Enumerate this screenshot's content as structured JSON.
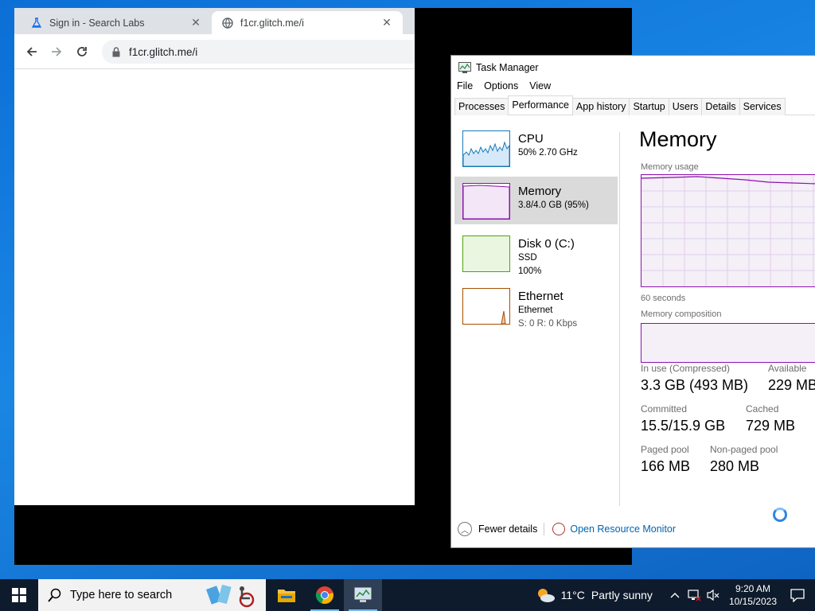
{
  "browser": {
    "tabs": [
      {
        "title": "Sign in - Search Labs",
        "icon": "flask-icon"
      },
      {
        "title": "f1cr.glitch.me/i",
        "icon": "globe-icon"
      }
    ],
    "url": "f1cr.glitch.me/i"
  },
  "task_manager": {
    "title": "Task Manager",
    "menu": [
      "File",
      "Options",
      "View"
    ],
    "tabs": [
      "Processes",
      "Performance",
      "App history",
      "Startup",
      "Users",
      "Details",
      "Services"
    ],
    "active_tab": "Performance",
    "sidebar": [
      {
        "name": "CPU",
        "sub1": "50%  2.70 GHz",
        "sub2": "",
        "color": "#1779ba"
      },
      {
        "name": "Memory",
        "sub1": "3.8/4.0 GB (95%)",
        "sub2": "",
        "color": "#8b12ae"
      },
      {
        "name": "Disk 0 (C:)",
        "sub1": "SSD",
        "sub2": "100%",
        "color": "#4da60c"
      },
      {
        "name": "Ethernet",
        "sub1": "Ethernet",
        "sub2": "S: 0  R: 0 Kbps",
        "color": "#a74f01"
      }
    ],
    "main": {
      "title": "Memory",
      "usage_label": "Memory usage",
      "time_label": "60 seconds",
      "composition_label": "Memory composition",
      "stats": {
        "in_use_label": "In use (Compressed)",
        "in_use_value": "3.3 GB (493 MB)",
        "available_label": "Available",
        "available_value": "229 MB",
        "committed_label": "Committed",
        "committed_value": "15.5/15.9 GB",
        "cached_label": "Cached",
        "cached_value": "729 MB",
        "paged_label": "Paged pool",
        "paged_value": "166 MB",
        "nonpaged_label": "Non-paged pool",
        "nonpaged_value": "280 MB"
      }
    },
    "footer": {
      "fewer_details": "Fewer details",
      "resource_monitor": "Open Resource Monitor"
    }
  },
  "taskbar": {
    "search_placeholder": "Type here to search",
    "weather_temp": "11°C",
    "weather_text": "Partly sunny",
    "time": "9:20 AM",
    "date": "10/15/2023"
  }
}
